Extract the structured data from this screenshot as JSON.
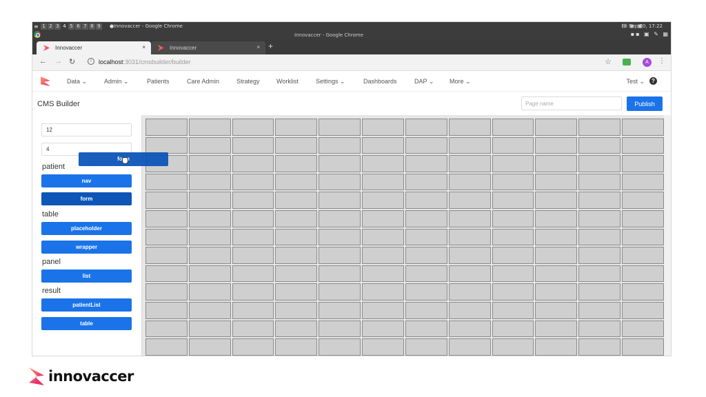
{
  "os": {
    "workspaces": [
      "1",
      "2",
      "3",
      "4",
      "5",
      "6",
      "7",
      "8",
      "9"
    ],
    "window_title": "●Innovaccer - Google Chrome",
    "center_title": "Innovaccer - Google Chrome",
    "clock": "Fri Sep 20, 17:22"
  },
  "browser": {
    "tabs": [
      {
        "title": "Innovaccer",
        "close": "×"
      },
      {
        "title": "Innovaccer",
        "close": "×"
      }
    ],
    "new_tab": "+",
    "url_host": "localhost",
    "url_rest": ":3031/cmsbuilder/builder",
    "profile_initial": "A"
  },
  "nav": {
    "items": [
      "Data ⌄",
      "Admin ⌄",
      "Patients",
      "Care Admin",
      "Strategy",
      "Worklist",
      "Settings ⌄",
      "Dashboards",
      "DAP ⌄",
      "More ⌄"
    ],
    "user": "Test ⌄",
    "help": "?"
  },
  "header": {
    "title": "CMS Builder",
    "page_name_placeholder": "Page name",
    "publish_label": "Publish"
  },
  "sidebar": {
    "columns_value": "12",
    "rows_value": "4",
    "groups": [
      {
        "label": "patient",
        "buttons": [
          "nav",
          "form"
        ]
      },
      {
        "label": "table",
        "buttons": [
          "placeholder",
          "wrapper"
        ]
      },
      {
        "label": "panel",
        "buttons": [
          "list"
        ]
      },
      {
        "label": "result",
        "buttons": [
          "patientList",
          "table"
        ]
      }
    ]
  },
  "drag": {
    "label": "form"
  },
  "grid": {
    "columns": 12,
    "rows": 14
  },
  "brand": {
    "name": "innovaccer"
  }
}
